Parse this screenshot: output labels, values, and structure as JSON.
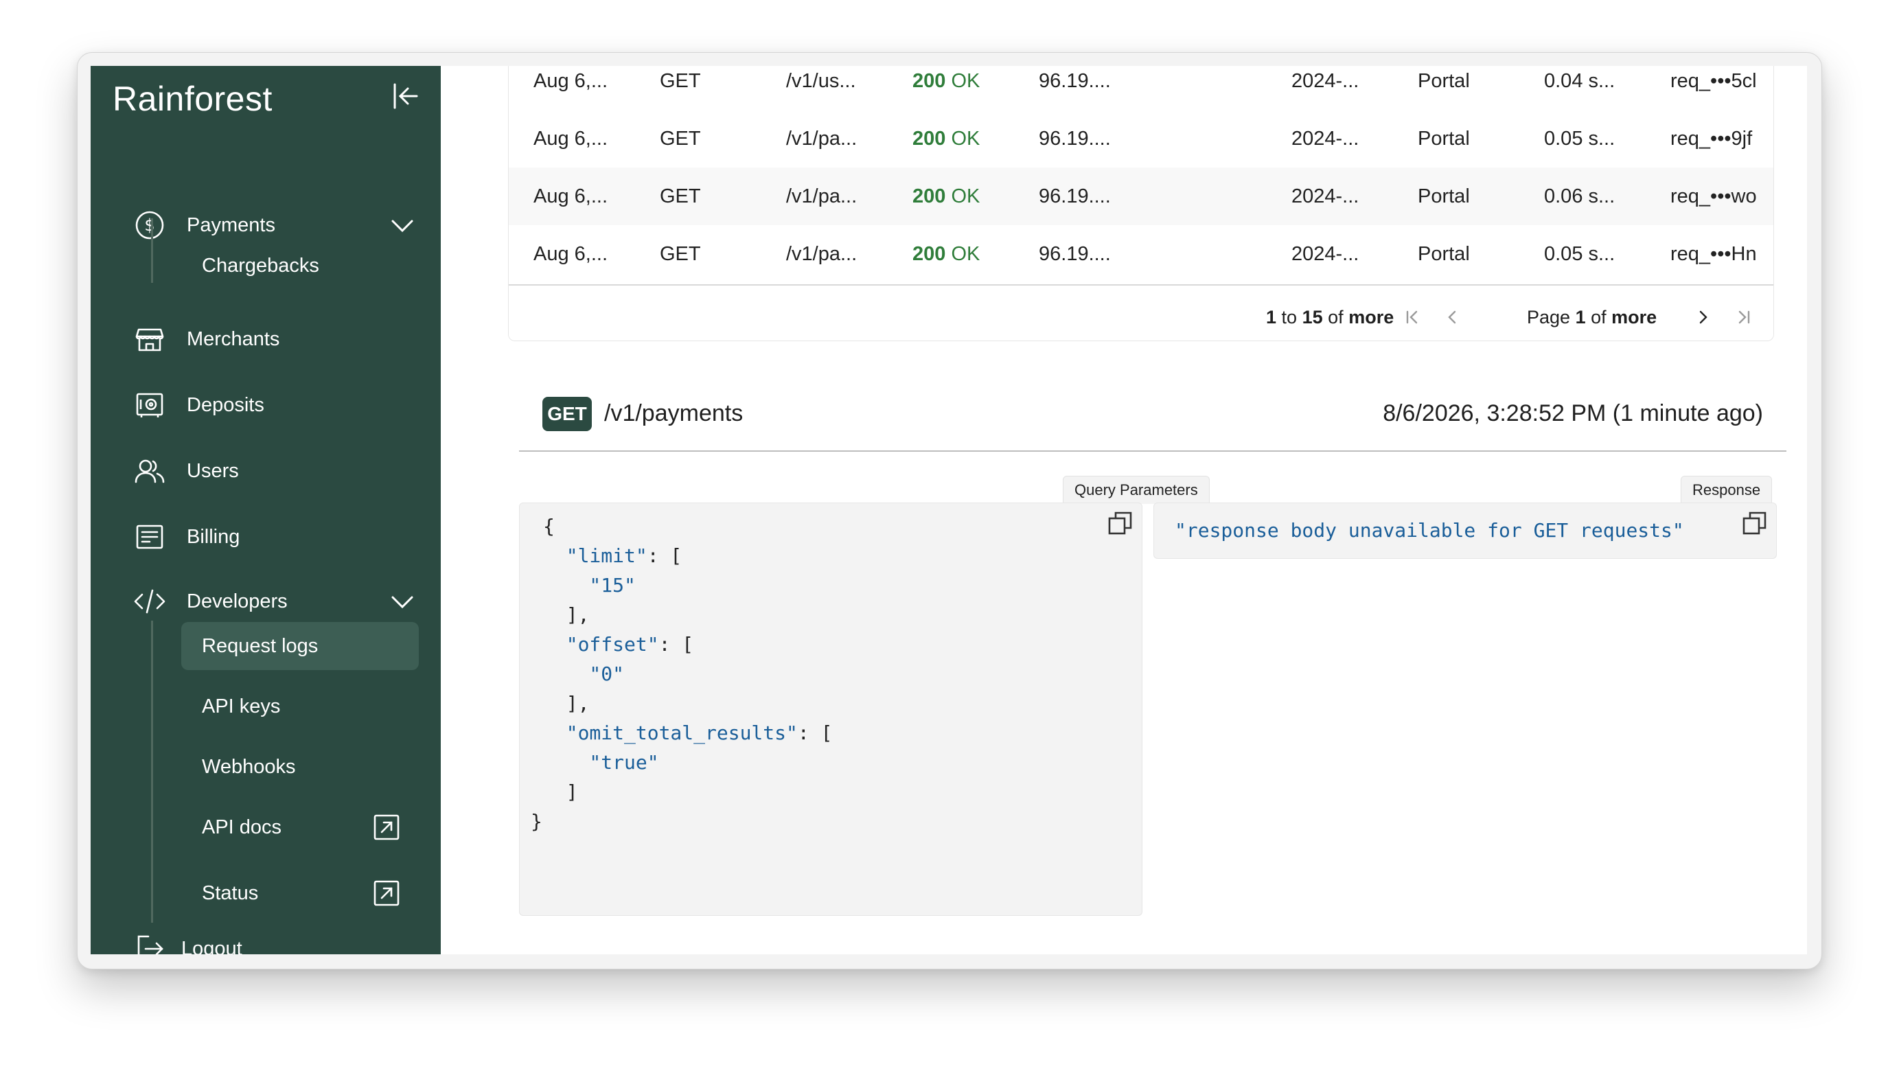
{
  "sidebar": {
    "brand": "Rainforest",
    "items": [
      {
        "label": "Payments",
        "icon": "dollar-circle-icon"
      },
      {
        "label": "Merchants",
        "icon": "store-icon"
      },
      {
        "label": "Deposits",
        "icon": "safe-icon"
      },
      {
        "label": "Users",
        "icon": "users-icon"
      },
      {
        "label": "Billing",
        "icon": "receipt-icon"
      },
      {
        "label": "Developers",
        "icon": "code-icon"
      }
    ],
    "payments_sub": [
      {
        "label": "Chargebacks"
      }
    ],
    "developers_sub": [
      {
        "label": "Request logs",
        "active": true
      },
      {
        "label": "API keys"
      },
      {
        "label": "Webhooks"
      },
      {
        "label": "API docs",
        "external": true
      },
      {
        "label": "Status",
        "external": true
      }
    ],
    "logout": "Logout"
  },
  "table": {
    "rows": [
      {
        "date": "Aug 6,...",
        "method": "GET",
        "path": "/v1/us...",
        "status_code": "200",
        "status_text": "OK",
        "ip": "96.19....",
        "version": "2024-...",
        "source": "Portal",
        "duration": "0.04 s...",
        "request_id": "req_•••5cl"
      },
      {
        "date": "Aug 6,...",
        "method": "GET",
        "path": "/v1/pa...",
        "status_code": "200",
        "status_text": "OK",
        "ip": "96.19....",
        "version": "2024-...",
        "source": "Portal",
        "duration": "0.05 s...",
        "request_id": "req_•••9jf"
      },
      {
        "date": "Aug 6,...",
        "method": "GET",
        "path": "/v1/pa...",
        "status_code": "200",
        "status_text": "OK",
        "ip": "96.19....",
        "version": "2024-...",
        "source": "Portal",
        "duration": "0.06 s...",
        "request_id": "req_•••wo"
      },
      {
        "date": "Aug 6,...",
        "method": "GET",
        "path": "/v1/pa...",
        "status_code": "200",
        "status_text": "OK",
        "ip": "96.19....",
        "version": "2024-...",
        "source": "Portal",
        "duration": "0.05 s...",
        "request_id": "req_•••Hn"
      }
    ],
    "pagination": {
      "range_start": "1",
      "to": "to",
      "range_end": "15",
      "of": "of",
      "more": "more",
      "page_label": "Page",
      "page": "1",
      "page_of": "of",
      "page_total": "more"
    }
  },
  "detail": {
    "method": "GET",
    "path": "/v1/payments",
    "timestamp": "8/6/2026, 3:28:52 PM (1 minute ago)",
    "query_tab": "Query Parameters",
    "response_tab": "Response",
    "query_lines": [
      "{",
      "  \"limit\": [",
      "    \"15\"",
      "  ],",
      "  \"offset\": [",
      "    \"0\"",
      "  ],",
      "  \"omit_total_results\": [",
      "    \"true\"",
      "  ]",
      "}"
    ],
    "response_body": "\"response body unavailable for GET requests\""
  },
  "colors": {
    "sidebar_bg": "#2b4a41",
    "active_item": "#3d5e54",
    "success": "#2f7d3a",
    "json_key": "#1a5e99"
  }
}
